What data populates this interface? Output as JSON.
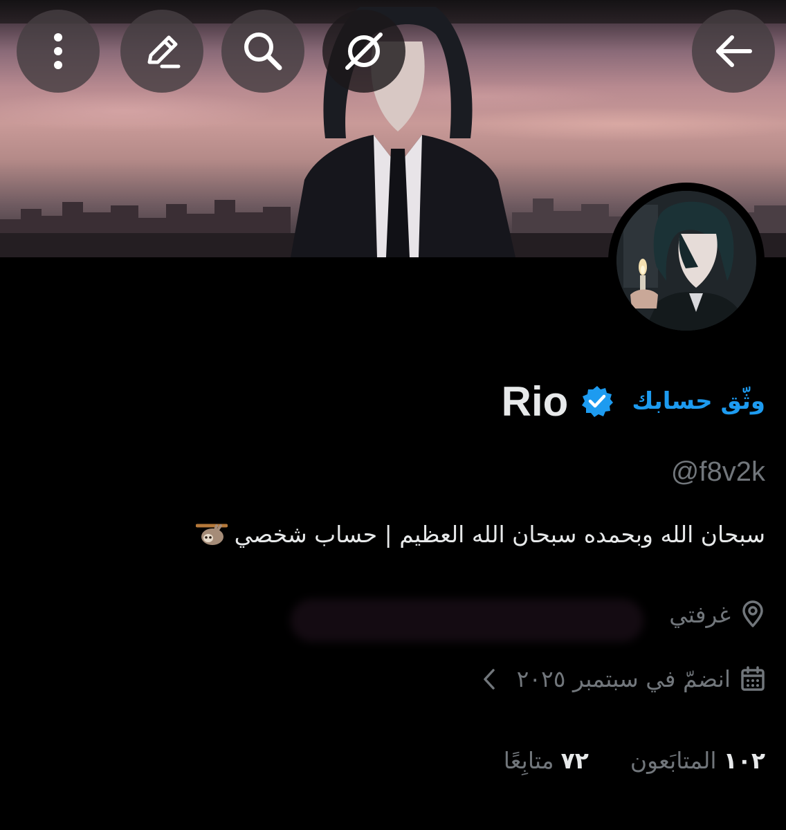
{
  "header": {
    "back_icon": "arrow-left-icon",
    "grok_icon": "grok-icon",
    "search_icon": "search-icon",
    "edit_icon": "pencil-icon",
    "more_icon": "more-vertical-icon"
  },
  "profile": {
    "display_name": "Rio",
    "verify_link": "وثّق حسابك",
    "handle": "@f8v2k",
    "bio": "سبحان الله وبحمده سبحان الله العظيم | حساب شخصي",
    "bio_emoji_icon": "sloth-icon",
    "location": "غرفتي",
    "joined": "انضمّ في سبتمبر ٢٠٢٥"
  },
  "stats": {
    "followers_count": "١٠٢",
    "followers_label": "المتابَعون",
    "following_count": "٧٢",
    "following_label": "متابِعًا"
  },
  "colors": {
    "background": "#000000",
    "accent": "#1d9bf0",
    "text_primary": "#e7e9ea",
    "text_secondary": "#71767b"
  }
}
